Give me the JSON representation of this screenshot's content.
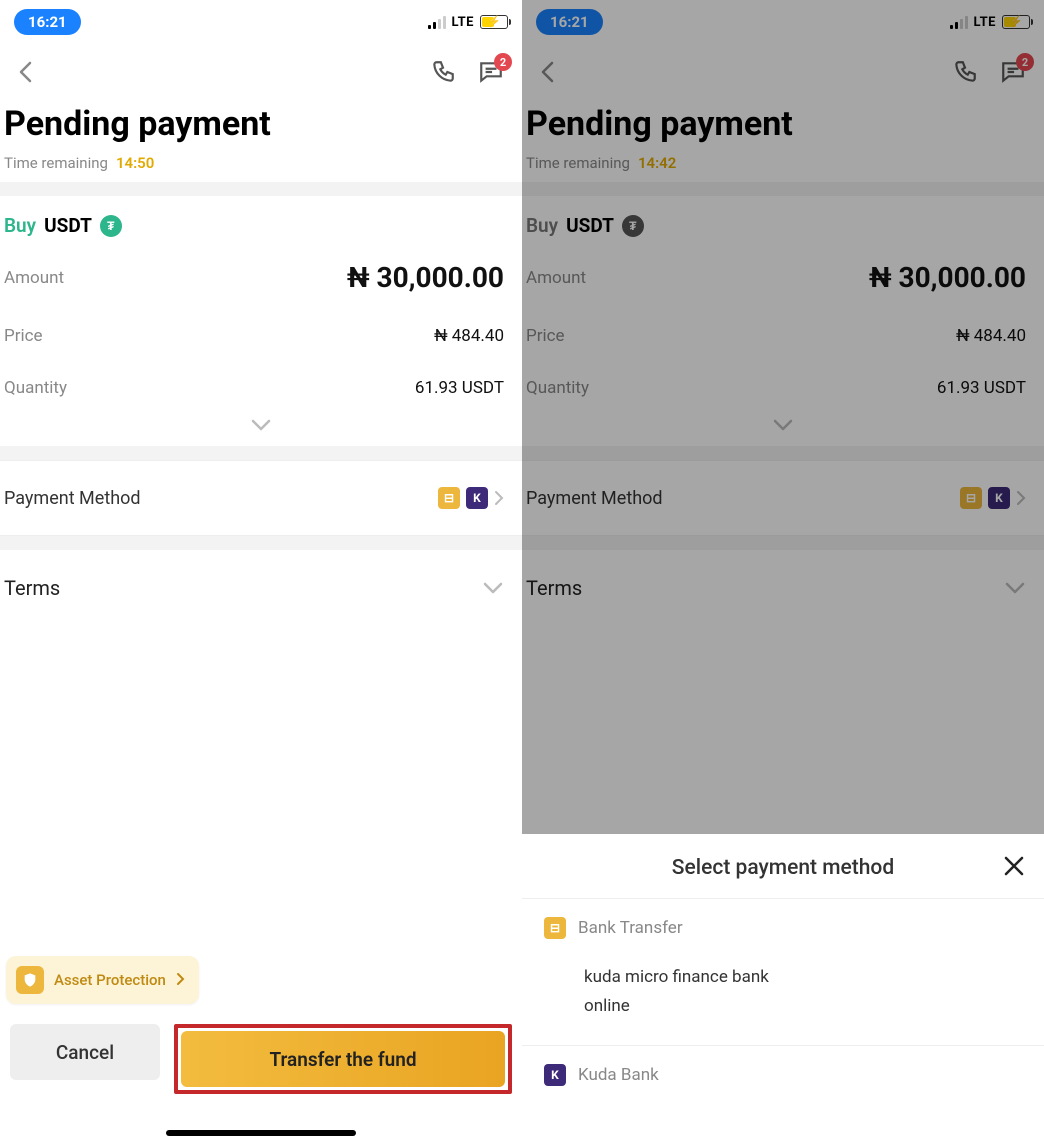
{
  "statusbar": {
    "time": "16:21",
    "network": "LTE"
  },
  "nav": {
    "badge_count": "2"
  },
  "title": "Pending payment",
  "time_remaining_label": "Time remaining",
  "left": {
    "time_remaining": "14:50"
  },
  "right": {
    "time_remaining": "14:42"
  },
  "order": {
    "side": "Buy",
    "asset": "USDT",
    "tether_symbol": "₮",
    "amount_label": "Amount",
    "amount_value": "₦ 30,000.00",
    "price_label": "Price",
    "price_value": "₦ 484.40",
    "quantity_label": "Quantity",
    "quantity_value": "61.93 USDT"
  },
  "payment_method_label": "Payment Method",
  "terms_label": "Terms",
  "asset_protection_label": "Asset Protection",
  "footer": {
    "cancel": "Cancel",
    "transfer": "Transfer the fund"
  },
  "sheet": {
    "title": "Select payment method",
    "options": {
      "bank_transfer": "Bank Transfer",
      "bank_transfer_detail_line1": "kuda micro finance bank",
      "bank_transfer_detail_line2": "online",
      "kuda": "Kuda Bank"
    }
  },
  "icons": {
    "pm_gold_glyph": "⊟",
    "pm_purple_glyph": "K"
  }
}
